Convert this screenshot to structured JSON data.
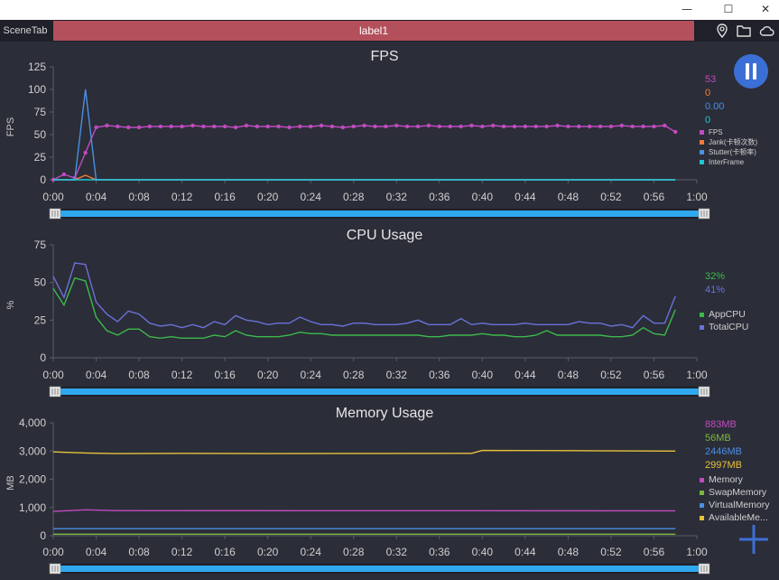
{
  "app": {
    "scene_tab": "SceneTab",
    "active_label": "label1"
  },
  "window_controls": {
    "minimize": "—",
    "maximize": "☐",
    "close": "✕"
  },
  "colors": {
    "fps": "#c04bc0",
    "jank": "#f07b3a",
    "stutter": "#4a90e2",
    "interframe": "#22c5d3",
    "appcpu": "#3cb94c",
    "totalcpu": "#6b72d8",
    "memory": "#c04bc0",
    "swap": "#7ab83c",
    "virtual": "#4a90e2",
    "available": "#e8c23b"
  },
  "icons": [
    "location-icon",
    "folder-icon",
    "cloud-icon",
    "pause-icon",
    "add-icon"
  ],
  "x_ticks": [
    "0:00",
    "0:04",
    "0:08",
    "0:12",
    "0:16",
    "0:20",
    "0:24",
    "0:28",
    "0:32",
    "0:36",
    "0:40",
    "0:44",
    "0:48",
    "0:52",
    "0:56",
    "1:00"
  ],
  "chart_data": [
    {
      "type": "line",
      "title": "FPS",
      "ylabel": "FPS",
      "ylim": [
        0,
        125
      ],
      "yticks": [
        "0",
        "25",
        "50",
        "75",
        "100",
        "125"
      ],
      "xlim": [
        0,
        60
      ],
      "legend_values": [
        "53",
        "0",
        "0.00",
        "0"
      ],
      "series": [
        {
          "name": "FPS",
          "x": [
            0,
            1,
            2,
            3,
            4,
            5,
            6,
            7,
            8,
            9,
            10,
            11,
            12,
            13,
            14,
            15,
            16,
            17,
            18,
            19,
            20,
            21,
            22,
            23,
            24,
            25,
            26,
            27,
            28,
            29,
            30,
            31,
            32,
            33,
            34,
            35,
            36,
            37,
            38,
            39,
            40,
            41,
            42,
            43,
            44,
            45,
            46,
            47,
            48,
            49,
            50,
            51,
            52,
            53,
            54,
            55,
            56,
            57,
            58
          ],
          "values": [
            0,
            6,
            2,
            30,
            58,
            60,
            59,
            58,
            58,
            59,
            59,
            59,
            59,
            60,
            59,
            59,
            59,
            58,
            60,
            59,
            59,
            59,
            58,
            59,
            59,
            60,
            59,
            58,
            59,
            60,
            59,
            59,
            60,
            59,
            59,
            60,
            59,
            59,
            59,
            60,
            59,
            60,
            59,
            59,
            59,
            59,
            59,
            60,
            59,
            59,
            59,
            59,
            59,
            60,
            59,
            59,
            59,
            60,
            53
          ]
        },
        {
          "name": "Jank(卡顿次数)",
          "x": [
            0,
            1,
            2,
            3,
            4,
            58
          ],
          "values": [
            0,
            0,
            0,
            5,
            0,
            0
          ]
        },
        {
          "name": "Stutter(卡顿率)",
          "x": [
            0,
            1,
            2,
            3,
            4,
            58
          ],
          "values": [
            0,
            0,
            0,
            100,
            0,
            0
          ]
        },
        {
          "name": "InterFrame",
          "x": [
            0,
            58
          ],
          "values": [
            0,
            0
          ]
        }
      ]
    },
    {
      "type": "line",
      "title": "CPU Usage",
      "ylabel": "%",
      "ylim": [
        0,
        75
      ],
      "yticks": [
        "0",
        "25",
        "50",
        "75"
      ],
      "xlim": [
        0,
        60
      ],
      "legend_values": [
        "32%",
        "41%"
      ],
      "series": [
        {
          "name": "AppCPU",
          "x": [
            0,
            1,
            2,
            3,
            4,
            5,
            6,
            7,
            8,
            9,
            10,
            11,
            12,
            13,
            14,
            15,
            16,
            17,
            18,
            19,
            20,
            21,
            22,
            23,
            24,
            25,
            26,
            27,
            28,
            29,
            30,
            31,
            32,
            33,
            34,
            35,
            36,
            37,
            38,
            39,
            40,
            41,
            42,
            43,
            44,
            45,
            46,
            47,
            48,
            49,
            50,
            51,
            52,
            53,
            54,
            55,
            56,
            57,
            58
          ],
          "values": [
            46,
            35,
            53,
            51,
            27,
            18,
            15,
            19,
            19,
            14,
            13,
            14,
            13,
            13,
            13,
            15,
            14,
            18,
            15,
            14,
            14,
            14,
            15,
            17,
            16,
            16,
            15,
            15,
            15,
            15,
            15,
            15,
            15,
            15,
            15,
            14,
            14,
            15,
            15,
            15,
            16,
            15,
            15,
            14,
            14,
            15,
            18,
            15,
            15,
            15,
            15,
            15,
            14,
            14,
            15,
            20,
            16,
            15,
            32
          ]
        },
        {
          "name": "TotalCPU",
          "x": [
            0,
            1,
            2,
            3,
            4,
            5,
            6,
            7,
            8,
            9,
            10,
            11,
            12,
            13,
            14,
            15,
            16,
            17,
            18,
            19,
            20,
            21,
            22,
            23,
            24,
            25,
            26,
            27,
            28,
            29,
            30,
            31,
            32,
            33,
            34,
            35,
            36,
            37,
            38,
            39,
            40,
            41,
            42,
            43,
            44,
            45,
            46,
            47,
            48,
            49,
            50,
            51,
            52,
            53,
            54,
            55,
            56,
            57,
            58
          ],
          "values": [
            54,
            40,
            63,
            62,
            37,
            29,
            24,
            31,
            29,
            23,
            21,
            22,
            20,
            22,
            20,
            24,
            22,
            28,
            25,
            24,
            22,
            23,
            23,
            27,
            24,
            22,
            22,
            21,
            23,
            23,
            22,
            22,
            22,
            23,
            25,
            22,
            22,
            22,
            26,
            22,
            23,
            22,
            22,
            22,
            23,
            22,
            22,
            22,
            22,
            24,
            23,
            23,
            21,
            22,
            20,
            28,
            23,
            23,
            41
          ]
        }
      ]
    },
    {
      "type": "line",
      "title": "Memory Usage",
      "ylabel": "MB",
      "ylim": [
        0,
        4000
      ],
      "yticks": [
        "0",
        "1,000",
        "2,000",
        "3,000",
        "4,000"
      ],
      "xlim": [
        0,
        60
      ],
      "legend_values": [
        "883MB",
        "56MB",
        "2446MB",
        "2997MB"
      ],
      "series": [
        {
          "name": "Memory",
          "x": [
            0,
            3,
            6,
            58
          ],
          "values": [
            860,
            920,
            890,
            883
          ]
        },
        {
          "name": "SwapMemory",
          "x": [
            0,
            58
          ],
          "values": [
            56,
            56
          ]
        },
        {
          "name": "VirtualMemory",
          "x": [
            0,
            58
          ],
          "values": [
            250,
            250
          ]
        },
        {
          "name": "AvailableMe...",
          "x": [
            0,
            3,
            6,
            12,
            20,
            30,
            39,
            40,
            50,
            58
          ],
          "values": [
            2970,
            2930,
            2910,
            2920,
            2910,
            2915,
            2920,
            3020,
            3010,
            2997
          ]
        }
      ]
    }
  ]
}
